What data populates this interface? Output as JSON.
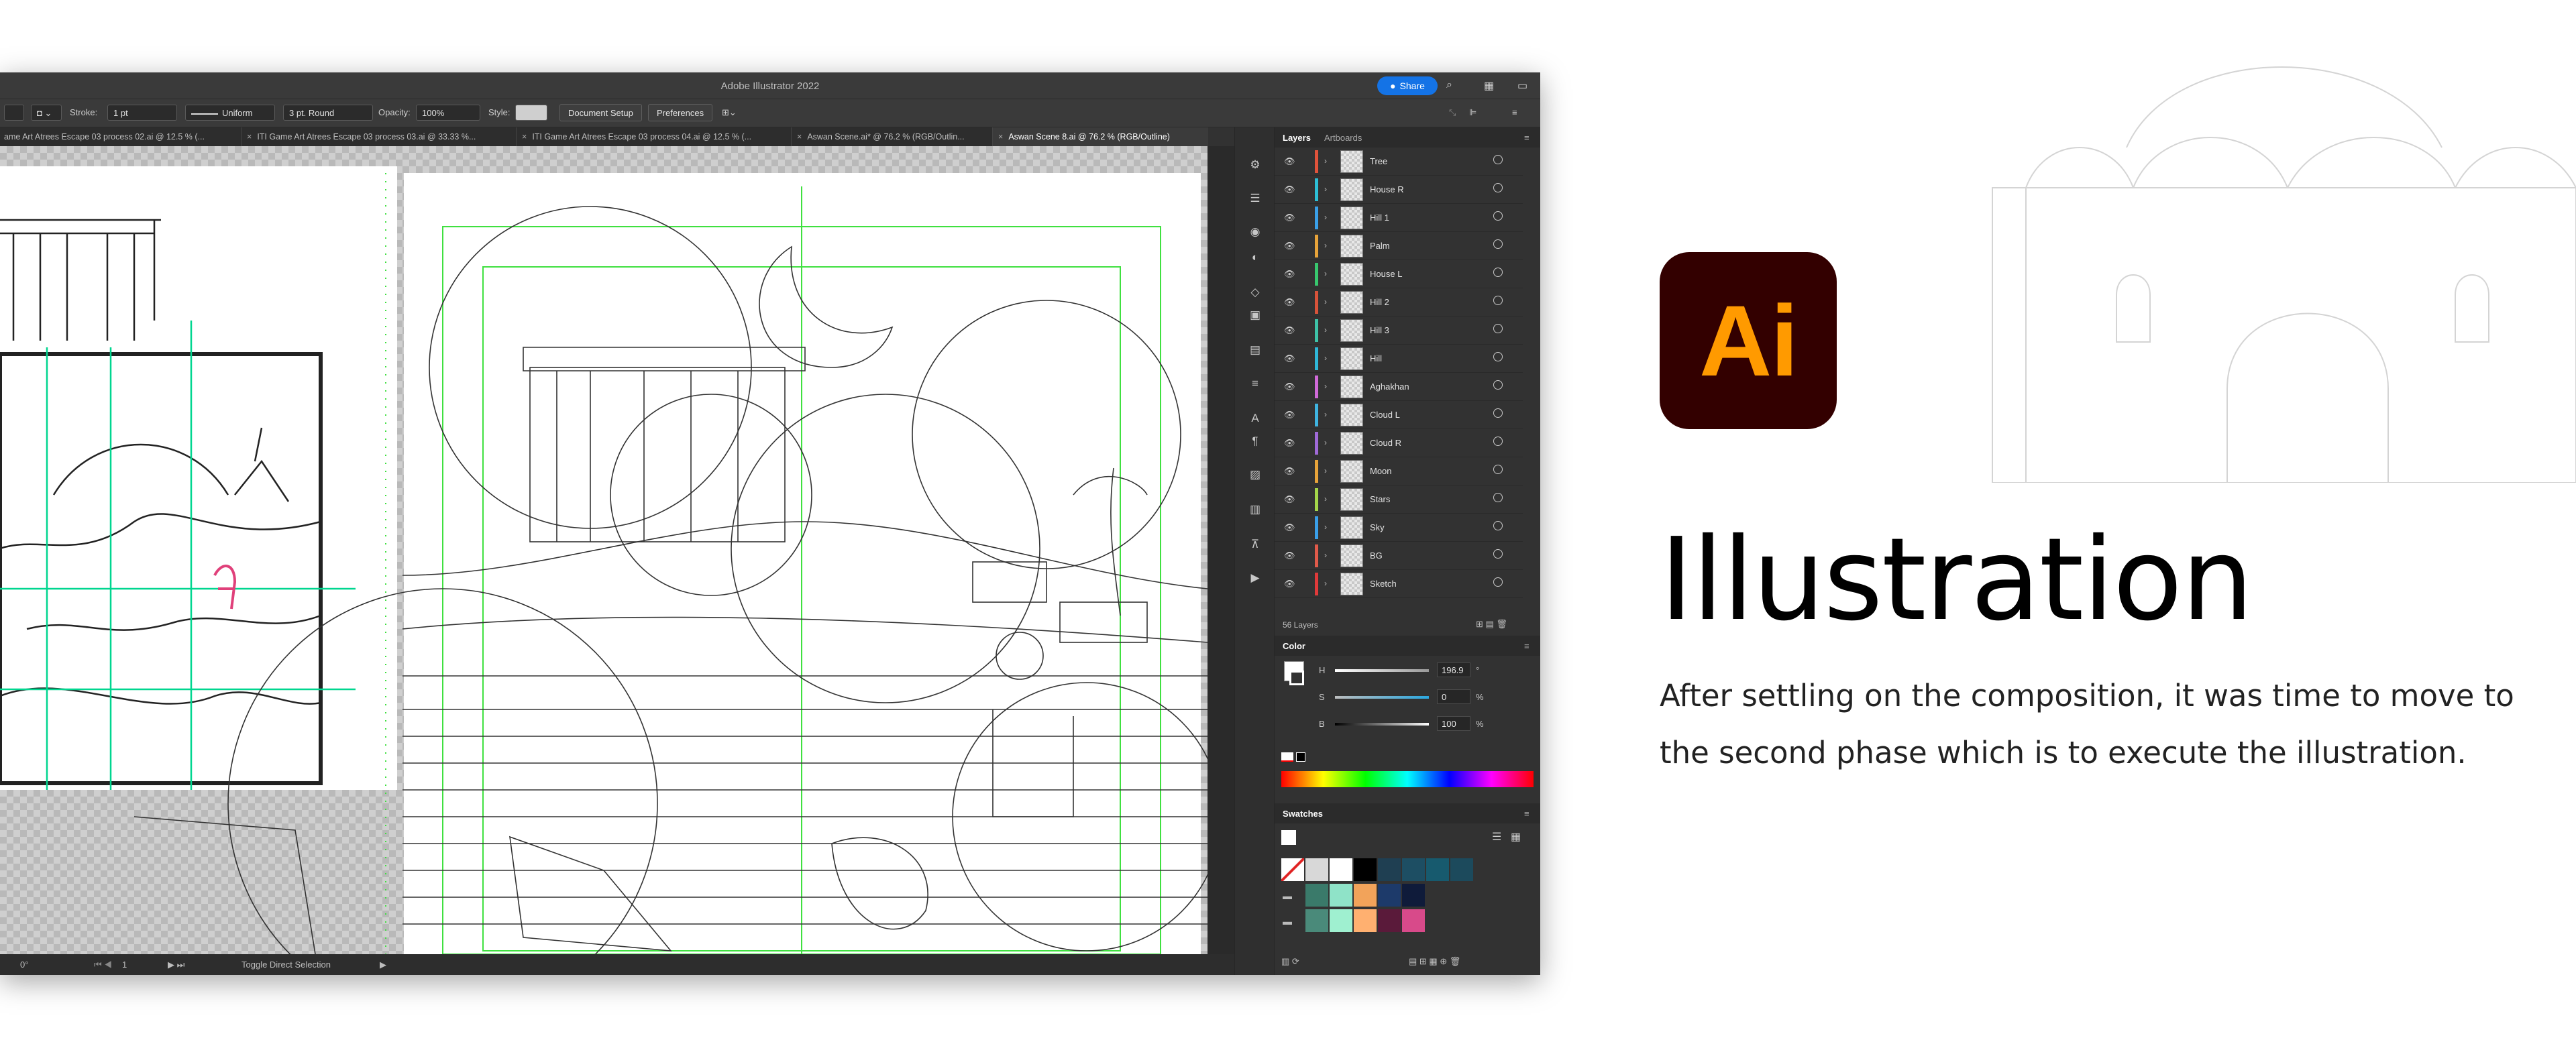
{
  "app": {
    "title": "Adobe Illustrator 2022",
    "share_label": "Share"
  },
  "control_bar": {
    "stroke_label": "Stroke:",
    "stroke_weight": "1 pt",
    "profile": "Uniform",
    "brush": "3 pt. Round",
    "opacity_label": "Opacity:",
    "opacity_value": "100%",
    "style_label": "Style:",
    "document_setup": "Document Setup",
    "preferences": "Preferences"
  },
  "tabs": [
    {
      "label": "ame Art Atrees Escape 03 process 02.ai @ 12.5 % (...",
      "active": false
    },
    {
      "label": "ITI Game Art Atrees Escape 03 process 03.ai @ 33.33 %...",
      "active": false
    },
    {
      "label": "ITI Game Art Atrees Escape 03 process 04.ai @ 12.5 % (...",
      "active": false
    },
    {
      "label": "Aswan Scene.ai* @ 76.2 % (RGB/Outlin...",
      "active": false
    },
    {
      "label": "Aswan Scene 8.ai @ 76.2 % (RGB/Outline)",
      "active": true
    }
  ],
  "status_bar": {
    "zoom": "0°",
    "artboard": "1",
    "tool": "Toggle Direct Selection"
  },
  "layers_panel": {
    "tabs": [
      "Layers",
      "Artboards"
    ],
    "layers": [
      {
        "name": "Tree",
        "color": "#e0533b"
      },
      {
        "name": "House R",
        "color": "#2dbfd6"
      },
      {
        "name": "Hill 1",
        "color": "#3aa0e8"
      },
      {
        "name": "Palm",
        "color": "#e7a33a"
      },
      {
        "name": "House L",
        "color": "#38c76e"
      },
      {
        "name": "Hill 2",
        "color": "#d8533a"
      },
      {
        "name": "Hill 3",
        "color": "#3ec3a8"
      },
      {
        "name": "Hill",
        "color": "#2fb7d8"
      },
      {
        "name": "Aghakhan",
        "color": "#d06ad8"
      },
      {
        "name": "Cloud L",
        "color": "#3fb4e0"
      },
      {
        "name": "Cloud R",
        "color": "#a06ad8"
      },
      {
        "name": "Moon",
        "color": "#e7a33a"
      },
      {
        "name": "Stars",
        "color": "#a4d64a"
      },
      {
        "name": "Sky",
        "color": "#3a9fe8"
      },
      {
        "name": "BG",
        "color": "#e05a4a"
      },
      {
        "name": "Sketch",
        "color": "#e03a3a"
      }
    ],
    "count_label": "56 Layers"
  },
  "color_panel": {
    "title": "Color",
    "h_label": "H",
    "h_value": "196.9",
    "h_unit": "°",
    "s_label": "S",
    "s_value": "0",
    "s_unit": "%",
    "b_label": "B",
    "b_value": "100",
    "b_unit": "%"
  },
  "swatches_panel": {
    "title": "Swatches",
    "rows": [
      [
        "#ffffff",
        "#d8d8d8",
        "#ffffff",
        "#000000",
        "#1f3f52",
        "#1d4e63",
        "#175a6e",
        "#1c4a5c"
      ],
      [
        "#3a7a6a",
        "#8fe3c8",
        "#f2a35a",
        "#1d3a6a",
        "#0f1b3a"
      ],
      [
        "#4a8a7a",
        "#9ff0d0",
        "#ffb070",
        "#5a1a3a",
        "#d84a8a"
      ]
    ]
  },
  "hero": {
    "logo_text": "Ai",
    "heading": "Illustration",
    "body": "After settling on the composition, it was time to move to the second phase which is to execute the illustration."
  }
}
